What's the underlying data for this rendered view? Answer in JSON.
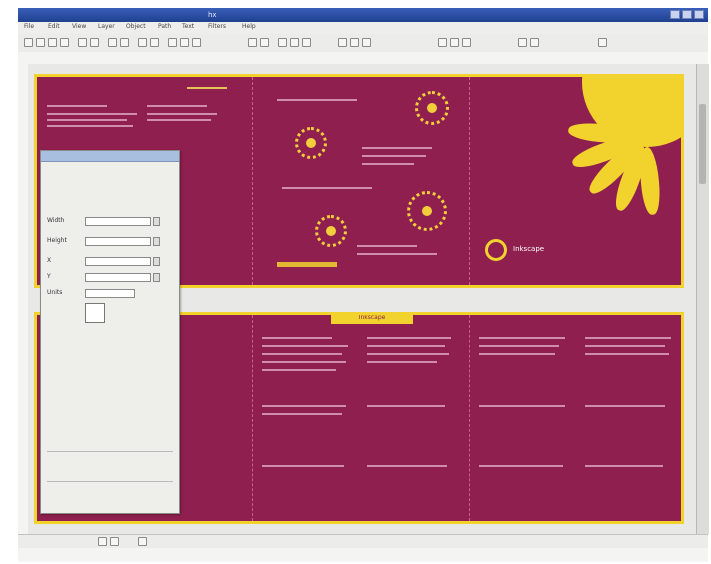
{
  "window": {
    "title": "hx"
  },
  "menu": {
    "items": [
      "File",
      "Edit",
      "View",
      "Layer",
      "Object",
      "Path",
      "Text",
      "Filters",
      "Help"
    ]
  },
  "document": {
    "cover_logo": "Inkscape",
    "spread_banner": "Inkscape"
  },
  "dialog": {
    "fields": [
      {
        "label": "Width",
        "value": ""
      },
      {
        "label": "Height",
        "value": ""
      },
      {
        "label": "X",
        "value": ""
      },
      {
        "label": "Y",
        "value": ""
      },
      {
        "label": "Units",
        "value": ""
      }
    ]
  },
  "colors": {
    "page": "#8f1f4f",
    "accent": "#f2d32e",
    "chrome": "#ececea",
    "titlebar": "#20408f"
  },
  "icons": [
    "new-icon",
    "open-icon",
    "save-icon",
    "print-icon",
    "zoom-icon",
    "align-icon",
    "node-icon"
  ]
}
